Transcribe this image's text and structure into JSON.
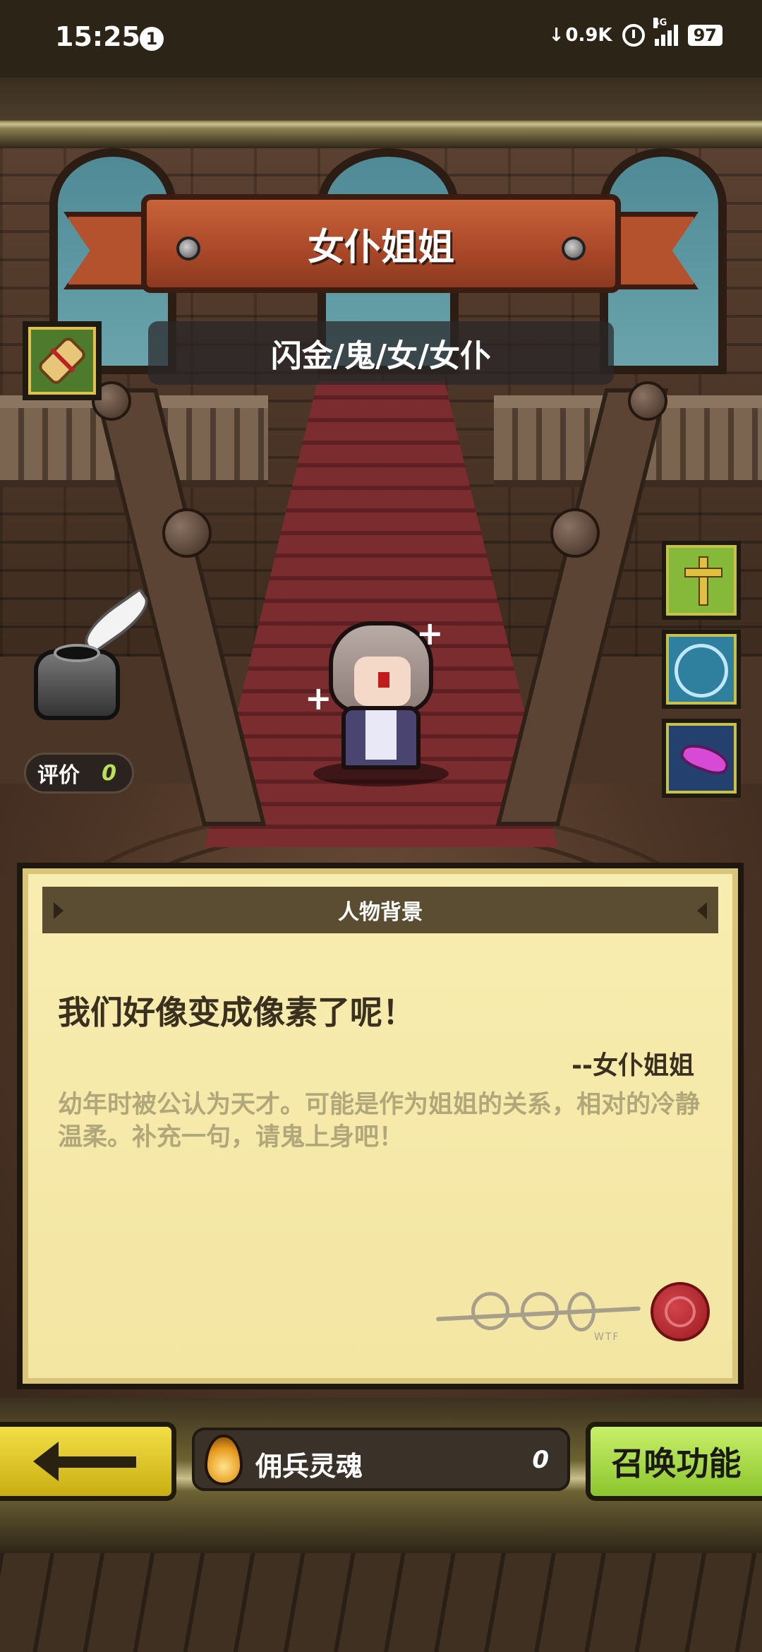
{
  "status_bar": {
    "time": "15:25",
    "notification_count": "1",
    "net_speed": "0.9K",
    "signal_label": "4G",
    "battery": "97"
  },
  "hero": {
    "name": "女仆姐姐",
    "tags": "闪金/鬼/女/女仆"
  },
  "rating": {
    "label": "评价",
    "value": "0"
  },
  "skills": [
    {
      "icon": "golden-cross-icon"
    },
    {
      "icon": "magic-circle-handshake-icon"
    },
    {
      "icon": "purple-claw-icon"
    }
  ],
  "background_card": {
    "header": "人物背景",
    "quote": "我们好像变成像素了呢！",
    "quote_author": "--女仆姐姐",
    "story": "幼年时被公认为天才。可能是作为姐姐的关系，相对的冷静温柔。补充一句，请鬼上身吧！",
    "signature_sub": "WTF"
  },
  "bottom_bar": {
    "soul_label": "佣兵灵魂",
    "soul_value": "0",
    "summon_label": "召唤功能"
  },
  "colors": {
    "banner": "#b5522e",
    "card": "#f8edb0",
    "back_button": "#f2df45",
    "summon_button": "#c8f06a"
  }
}
